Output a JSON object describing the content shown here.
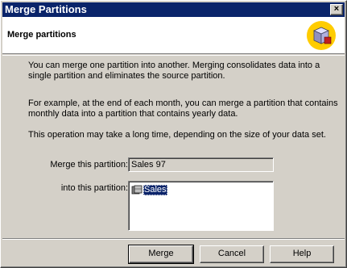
{
  "window": {
    "title": "Merge Partitions"
  },
  "header": {
    "title": "Merge partitions",
    "icon": "cube-merge-icon"
  },
  "description": {
    "p1": "You can merge one partition into another. Merging consolidates data into a single partition and eliminates the source partition.",
    "p2": "For example, at the end of each month, you can merge a partition that contains monthly data into a partition that contains yearly data.",
    "p3": "This operation may take a long time, depending on the size of your data set."
  },
  "form": {
    "source_label": "Merge this partition:",
    "source_value": "Sales 97",
    "target_label": "into this partition:",
    "target_items": [
      "Sales"
    ]
  },
  "buttons": {
    "merge": "Merge",
    "cancel": "Cancel",
    "help": "Help"
  },
  "colors": {
    "titlebar": "#0a246a",
    "face": "#d4d0c8",
    "icon_circle": "#ffcc00"
  }
}
